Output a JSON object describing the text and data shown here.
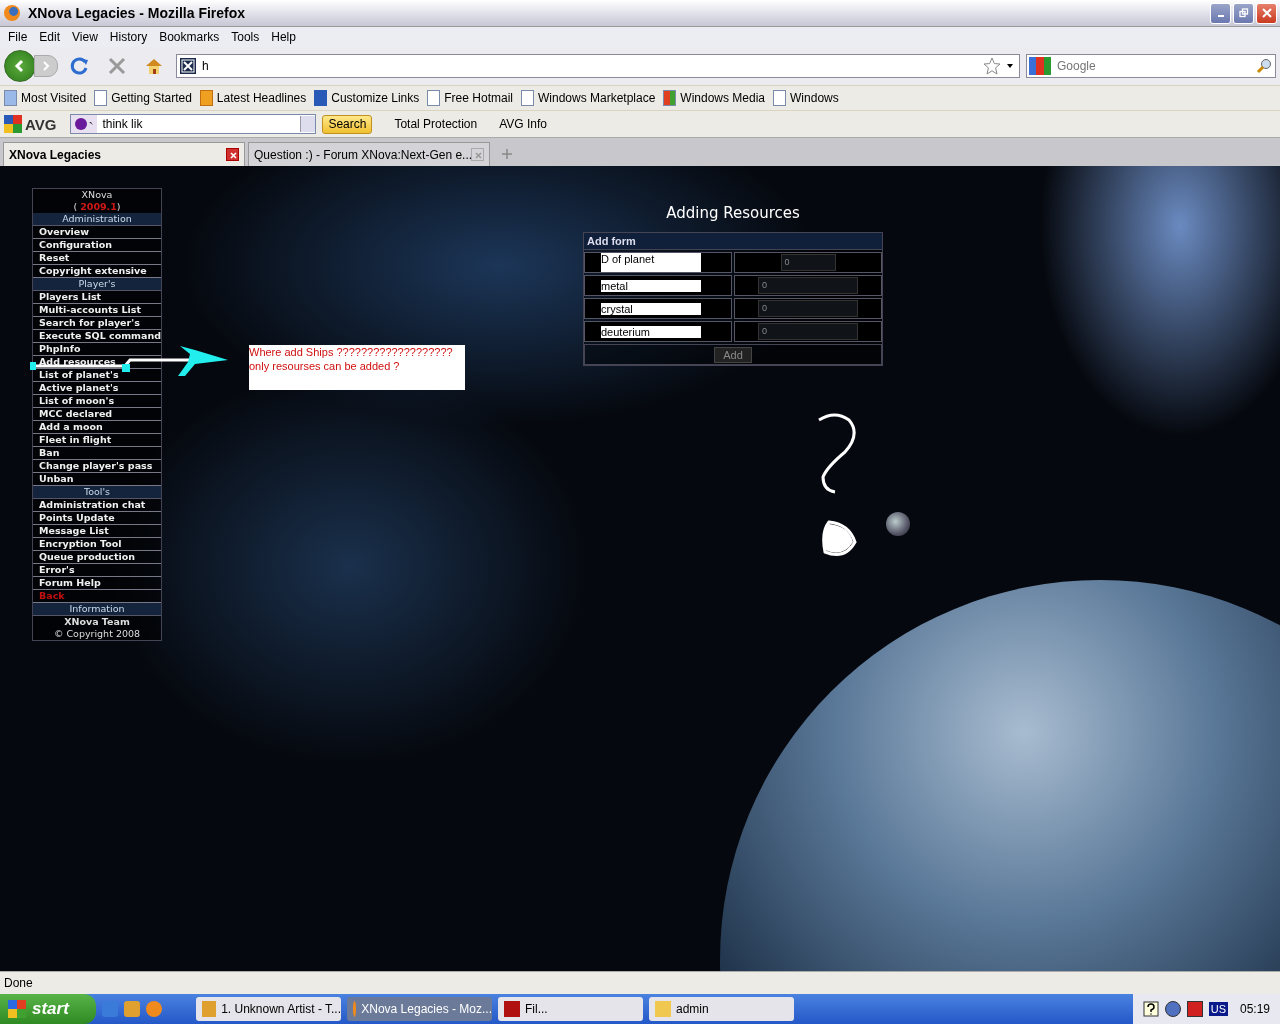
{
  "window": {
    "title": "XNova Legacies - Mozilla Firefox"
  },
  "menu_bar": [
    "File",
    "Edit",
    "View",
    "History",
    "Bookmarks",
    "Tools",
    "Help"
  ],
  "address_bar": {
    "value": "h"
  },
  "search_bar": {
    "placeholder": "Google"
  },
  "bookmarks": [
    "Most Visited",
    "Getting Started",
    "Latest Headlines",
    "Customize Links",
    "Free Hotmail",
    "Windows Marketplace",
    "Windows Media",
    "Windows"
  ],
  "avg_toolbar": {
    "brand": "AVG",
    "search_value": "think lik",
    "search_button": "Search",
    "items": [
      "Total Protection",
      "AVG Info"
    ]
  },
  "tabs": [
    {
      "label": "XNova Legacies",
      "selected": true
    },
    {
      "label": "Question :) - Forum XNova:Next-Gen e...",
      "selected": false
    }
  ],
  "admin_menu": {
    "title": "XNova",
    "version_open": "(",
    "version": "2009.1",
    "version_close": ")",
    "items": [
      {
        "kind": "section",
        "label": "Administration"
      },
      {
        "kind": "link",
        "label": "Overview"
      },
      {
        "kind": "link",
        "label": "Configuration"
      },
      {
        "kind": "link",
        "label": "Reset"
      },
      {
        "kind": "link",
        "label": "Copyright extensive"
      },
      {
        "kind": "section",
        "label": "Player's"
      },
      {
        "kind": "link",
        "label": "Players List"
      },
      {
        "kind": "link",
        "label": "Multi-accounts List"
      },
      {
        "kind": "link",
        "label": "Search for player's"
      },
      {
        "kind": "link",
        "label": "Execute SQL command"
      },
      {
        "kind": "link",
        "label": "PhpInfo"
      },
      {
        "kind": "link",
        "label": "Add resources"
      },
      {
        "kind": "link",
        "label": "List of planet's"
      },
      {
        "kind": "link",
        "label": "Active planet's"
      },
      {
        "kind": "link",
        "label": "List of moon's"
      },
      {
        "kind": "link",
        "label": "MCC declared"
      },
      {
        "kind": "link",
        "label": "Add a moon"
      },
      {
        "kind": "link",
        "label": "Fleet in flight"
      },
      {
        "kind": "link",
        "label": "Ban"
      },
      {
        "kind": "link",
        "label": "Change player's pass"
      },
      {
        "kind": "link",
        "label": "Unban"
      },
      {
        "kind": "section",
        "label": "Tool's"
      },
      {
        "kind": "link",
        "label": "Administration chat"
      },
      {
        "kind": "link",
        "label": "Points Update"
      },
      {
        "kind": "link",
        "label": "Message List"
      },
      {
        "kind": "link",
        "label": "Encryption Tool"
      },
      {
        "kind": "link",
        "label": "Queue production"
      },
      {
        "kind": "link",
        "label": "Error's"
      },
      {
        "kind": "link",
        "label": "Forum Help"
      },
      {
        "kind": "back",
        "label": "Back"
      },
      {
        "kind": "section",
        "label": "Information"
      },
      {
        "kind": "footer_bold",
        "label": "XNova Team"
      },
      {
        "kind": "footer",
        "label": "© Copyright 2008"
      }
    ]
  },
  "page_title": "Adding Resources",
  "add_form": {
    "header": "Add form",
    "rows": [
      {
        "label": "D of planet",
        "value": "0"
      },
      {
        "label": "metal",
        "value": "0"
      },
      {
        "label": "crystal",
        "value": "0"
      },
      {
        "label": "deuterium",
        "value": "0"
      }
    ],
    "button": "Add"
  },
  "annotation": {
    "lines": [
      "Where add Ships ???????????????????",
      "only resourses can be added ?"
    ]
  },
  "status_bar": {
    "text": "Done"
  },
  "taskbar": {
    "start": "start",
    "tasks": [
      {
        "label": "1. Unknown Artist - T...",
        "selected": false
      },
      {
        "label": "XNova Legacies - Moz...",
        "selected": true
      },
      {
        "label": "Fil...",
        "selected": false
      },
      {
        "label": "admin",
        "selected": false
      }
    ],
    "language": "US",
    "clock": "05:19"
  }
}
